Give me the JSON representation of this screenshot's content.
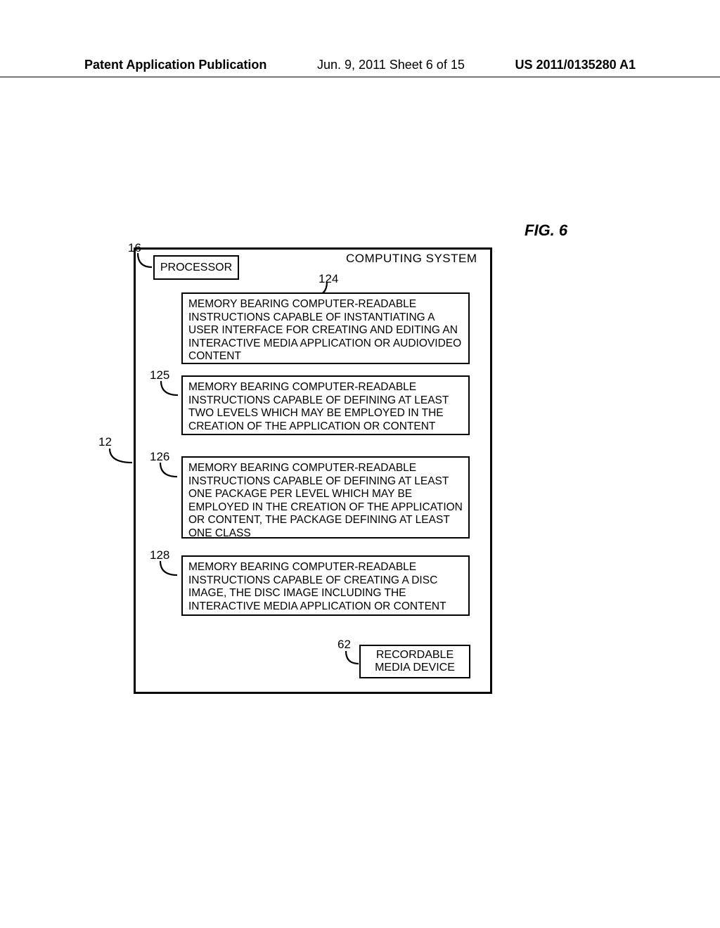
{
  "header": {
    "left": "Patent Application Publication",
    "mid": "Jun. 9, 2011  Sheet 6 of 15",
    "right": "US 2011/0135280 A1"
  },
  "figure_label": "FIG. 6",
  "refs": {
    "r12": "12",
    "r16": "16",
    "r62": "62",
    "r124": "124",
    "r125": "125",
    "r126": "126",
    "r128": "128"
  },
  "labels": {
    "computing_system": "COMPUTING SYSTEM",
    "processor": "PROCESSOR",
    "recordable_media": "RECORDABLE MEDIA DEVICE"
  },
  "memory_blocks": {
    "b124": "MEMORY BEARING COMPUTER-READABLE INSTRUCTIONS CAPABLE OF INSTANTIATING A USER INTERFACE FOR CREATING AND EDITING AN INTERACTIVE MEDIA APPLICATION OR AUDIOVIDEO CONTENT",
    "b125": "MEMORY BEARING COMPUTER-READABLE INSTRUCTIONS CAPABLE OF DEFINING AT LEAST TWO LEVELS WHICH MAY BE EMPLOYED IN THE CREATION OF THE APPLICATION OR CONTENT",
    "b126": "MEMORY BEARING COMPUTER-READABLE INSTRUCTIONS CAPABLE OF DEFINING AT LEAST ONE PACKAGE PER LEVEL WHICH MAY BE EMPLOYED IN THE CREATION OF THE APPLICATION OR CONTENT, THE PACKAGE DEFINING AT LEAST ONE CLASS",
    "b128": "MEMORY BEARING COMPUTER-READABLE INSTRUCTIONS CAPABLE OF CREATING A DISC IMAGE, THE DISC IMAGE INCLUDING THE INTERACTIVE MEDIA APPLICATION OR CONTENT"
  }
}
